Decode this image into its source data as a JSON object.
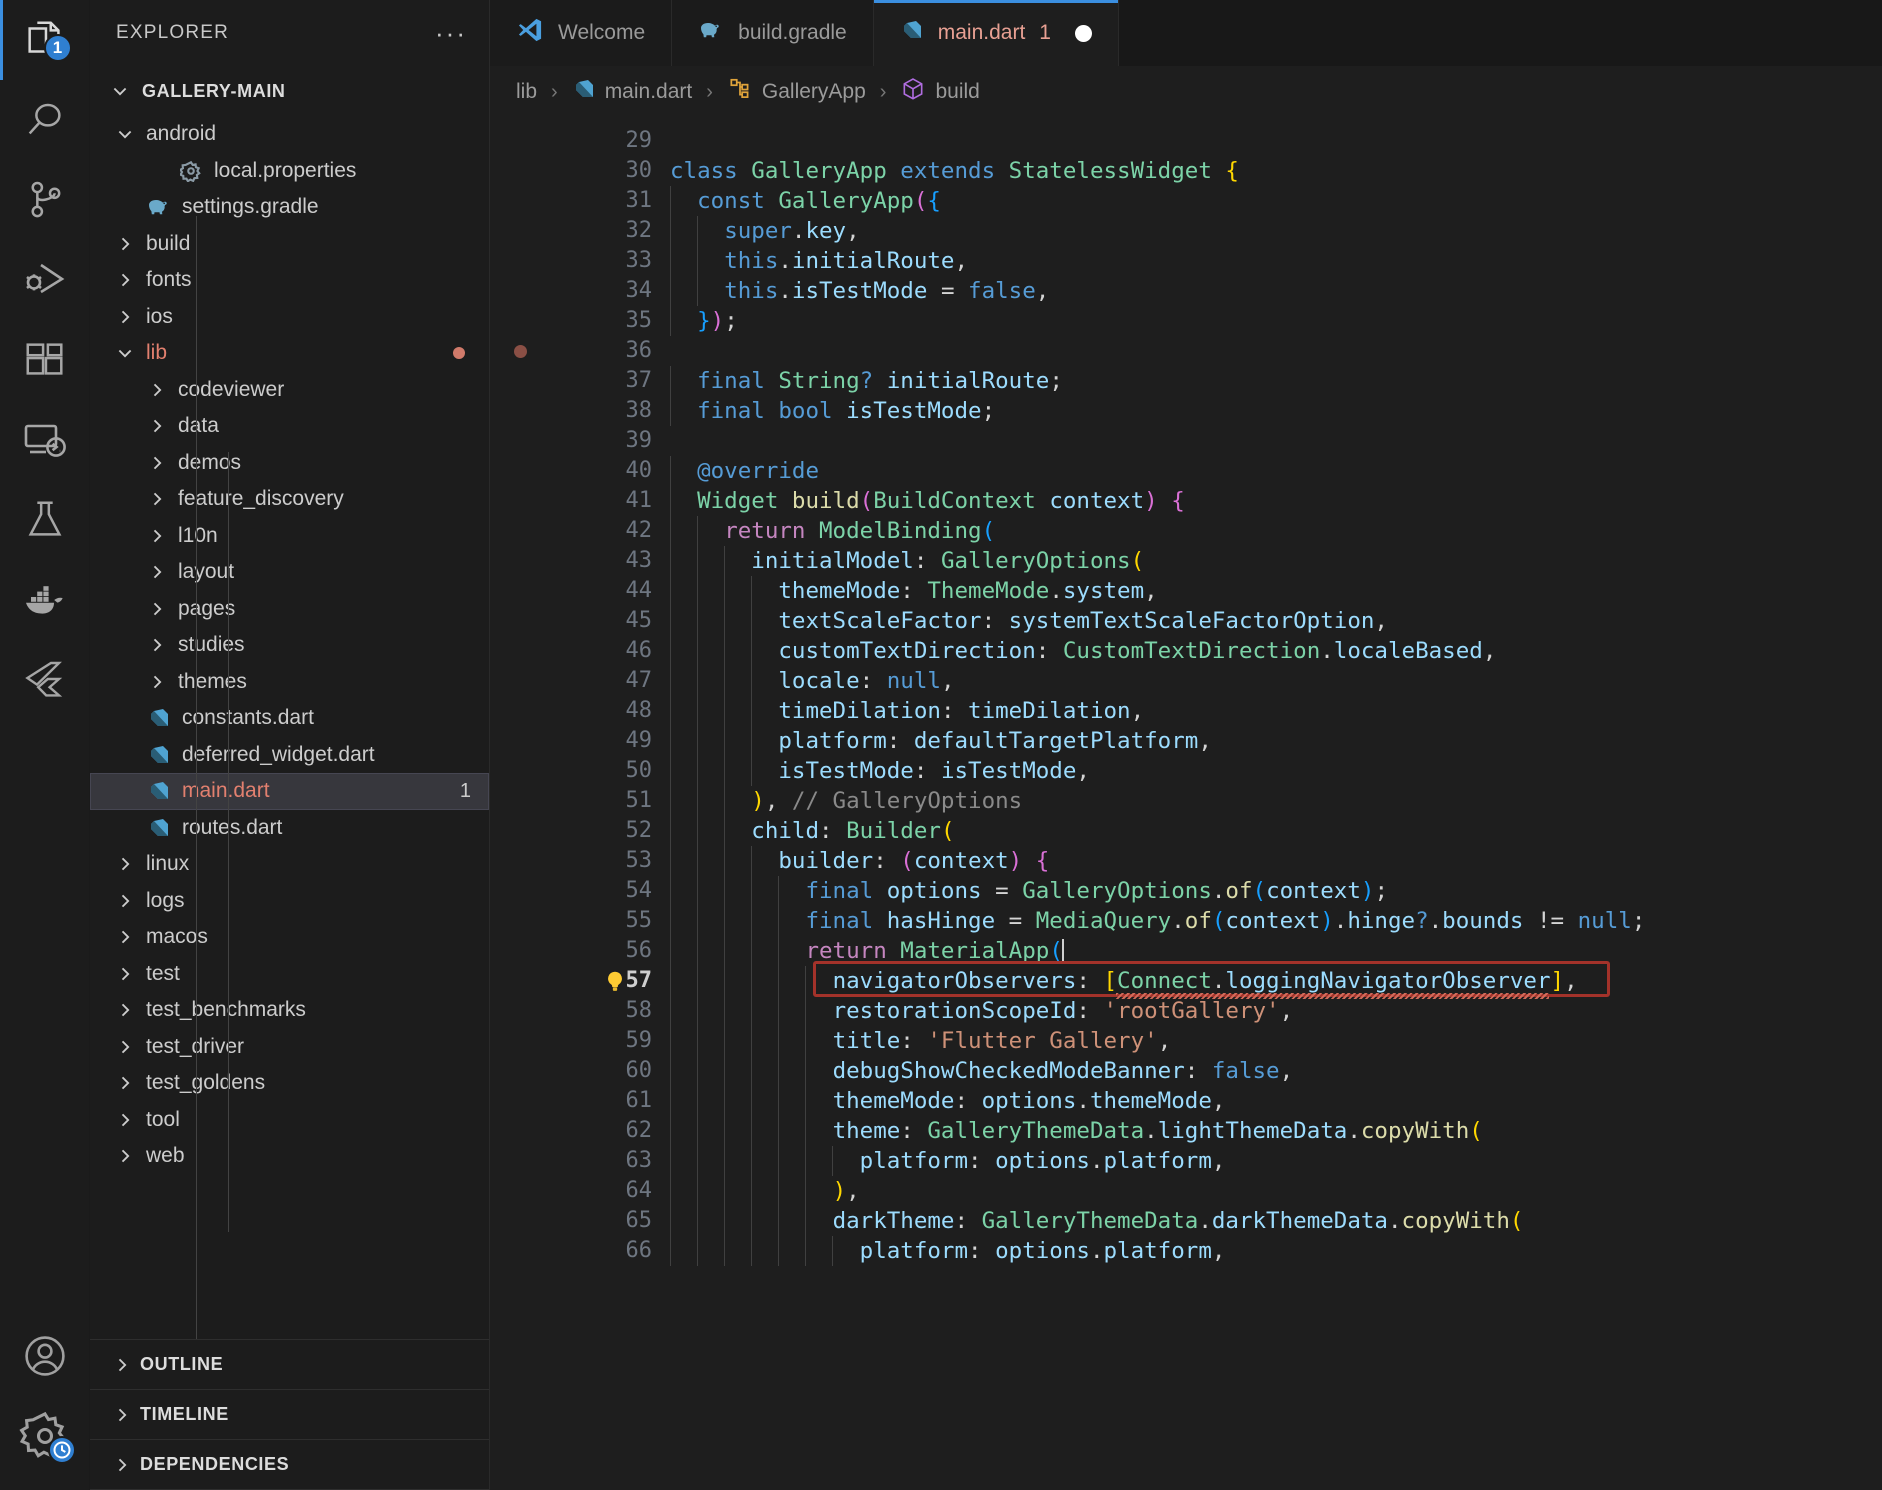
{
  "activity_bar": {
    "items": [
      {
        "name": "explorer",
        "icon": "files-icon",
        "badge": "1",
        "active": true
      },
      {
        "name": "search",
        "icon": "search-icon",
        "badge": "",
        "active": false
      },
      {
        "name": "source-control",
        "icon": "source-control-icon",
        "badge": "",
        "active": false
      },
      {
        "name": "run-and-debug",
        "icon": "run-debug-icon",
        "badge": "",
        "active": false
      },
      {
        "name": "extensions",
        "icon": "extensions-icon",
        "badge": "",
        "active": false
      },
      {
        "name": "remote-explorer",
        "icon": "remote-explorer-icon",
        "badge": "",
        "active": false
      },
      {
        "name": "testing",
        "icon": "beaker-icon",
        "badge": "",
        "active": false
      },
      {
        "name": "docker",
        "icon": "docker-whale-icon",
        "badge": "",
        "active": false
      },
      {
        "name": "flutter",
        "icon": "flutter-icon",
        "badge": "",
        "active": false
      }
    ],
    "bottom_items": [
      {
        "name": "accounts",
        "icon": "account-circle-icon"
      },
      {
        "name": "manage-settings",
        "icon": "gear-icon",
        "badge_icon": "clock-icon"
      }
    ]
  },
  "sidebar": {
    "title": "EXPLORER",
    "more_actions": "···",
    "workspace": "GALLERY-MAIN",
    "tree": [
      {
        "label": "android",
        "depth": 0,
        "kind": "folder",
        "expanded": true,
        "icon": "chevron-down-icon"
      },
      {
        "label": "local.properties",
        "depth": 2,
        "kind": "file",
        "icon": "gear-file-icon"
      },
      {
        "label": "settings.gradle",
        "depth": 1,
        "kind": "file",
        "icon": "gradle-elephant-icon"
      },
      {
        "label": "build",
        "depth": 0,
        "kind": "folder",
        "expanded": false,
        "icon": "chevron-right-icon"
      },
      {
        "label": "fonts",
        "depth": 0,
        "kind": "folder",
        "expanded": false,
        "icon": "chevron-right-icon"
      },
      {
        "label": "ios",
        "depth": 0,
        "kind": "folder",
        "expanded": false,
        "icon": "chevron-right-icon"
      },
      {
        "label": "lib",
        "depth": 0,
        "kind": "folder",
        "expanded": true,
        "icon": "chevron-down-icon",
        "modified": true,
        "dot": true
      },
      {
        "label": "codeviewer",
        "depth": 1,
        "kind": "folder",
        "expanded": false,
        "icon": "chevron-right-icon"
      },
      {
        "label": "data",
        "depth": 1,
        "kind": "folder",
        "expanded": false,
        "icon": "chevron-right-icon"
      },
      {
        "label": "demos",
        "depth": 1,
        "kind": "folder",
        "expanded": false,
        "icon": "chevron-right-icon"
      },
      {
        "label": "feature_discovery",
        "depth": 1,
        "kind": "folder",
        "expanded": false,
        "icon": "chevron-right-icon"
      },
      {
        "label": "l10n",
        "depth": 1,
        "kind": "folder",
        "expanded": false,
        "icon": "chevron-right-icon"
      },
      {
        "label": "layout",
        "depth": 1,
        "kind": "folder",
        "expanded": false,
        "icon": "chevron-right-icon"
      },
      {
        "label": "pages",
        "depth": 1,
        "kind": "folder",
        "expanded": false,
        "icon": "chevron-right-icon"
      },
      {
        "label": "studies",
        "depth": 1,
        "kind": "folder",
        "expanded": false,
        "icon": "chevron-right-icon"
      },
      {
        "label": "themes",
        "depth": 1,
        "kind": "folder",
        "expanded": false,
        "icon": "chevron-right-icon"
      },
      {
        "label": "constants.dart",
        "depth": 1,
        "kind": "file",
        "icon": "dart-icon"
      },
      {
        "label": "deferred_widget.dart",
        "depth": 1,
        "kind": "file",
        "icon": "dart-icon"
      },
      {
        "label": "main.dart",
        "depth": 1,
        "kind": "file",
        "icon": "dart-icon",
        "modified": true,
        "selected": true,
        "count": "1"
      },
      {
        "label": "routes.dart",
        "depth": 1,
        "kind": "file",
        "icon": "dart-icon"
      },
      {
        "label": "linux",
        "depth": 0,
        "kind": "folder",
        "expanded": false,
        "icon": "chevron-right-icon"
      },
      {
        "label": "logs",
        "depth": 0,
        "kind": "folder",
        "expanded": false,
        "icon": "chevron-right-icon"
      },
      {
        "label": "macos",
        "depth": 0,
        "kind": "folder",
        "expanded": false,
        "icon": "chevron-right-icon"
      },
      {
        "label": "test",
        "depth": 0,
        "kind": "folder",
        "expanded": false,
        "icon": "chevron-right-icon"
      },
      {
        "label": "test_benchmarks",
        "depth": 0,
        "kind": "folder",
        "expanded": false,
        "icon": "chevron-right-icon"
      },
      {
        "label": "test_driver",
        "depth": 0,
        "kind": "folder",
        "expanded": false,
        "icon": "chevron-right-icon"
      },
      {
        "label": "test_goldens",
        "depth": 0,
        "kind": "folder",
        "expanded": false,
        "icon": "chevron-right-icon"
      },
      {
        "label": "tool",
        "depth": 0,
        "kind": "folder",
        "expanded": false,
        "icon": "chevron-right-icon"
      },
      {
        "label": "web",
        "depth": 0,
        "kind": "folder",
        "expanded": false,
        "icon": "chevron-right-icon"
      }
    ],
    "bottom_sections": [
      {
        "label": "OUTLINE",
        "icon": "chevron-right-icon"
      },
      {
        "label": "TIMELINE",
        "icon": "chevron-right-icon"
      },
      {
        "label": "DEPENDENCIES",
        "icon": "chevron-right-icon"
      }
    ]
  },
  "tabs": [
    {
      "label": "Welcome",
      "icon": "vscode-logo-icon",
      "active": false,
      "dirty": false,
      "count": ""
    },
    {
      "label": "build.gradle",
      "icon": "gradle-elephant-icon",
      "active": false,
      "dirty": false,
      "count": ""
    },
    {
      "label": "main.dart",
      "icon": "dart-icon",
      "active": true,
      "dirty": true,
      "count": "1"
    }
  ],
  "breadcrumb": [
    {
      "label": "lib",
      "icon": ""
    },
    {
      "label": "main.dart",
      "icon": "dart-icon"
    },
    {
      "label": "GalleryApp",
      "icon": "class-symbol-icon"
    },
    {
      "label": "build",
      "icon": "method-symbol-icon"
    }
  ],
  "editor": {
    "first_line": 29,
    "current_line": 57,
    "breakpoint_line": 36,
    "lightbulb_line": 57,
    "error_line_text": "navigatorObservers: [Connect.loggingNavigatorObserver],",
    "lines": [
      {
        "n": 29,
        "text": ""
      },
      {
        "n": 30,
        "text": "class GalleryApp extends StatelessWidget {"
      },
      {
        "n": 31,
        "text": "  const GalleryApp({"
      },
      {
        "n": 32,
        "text": "    super.key,"
      },
      {
        "n": 33,
        "text": "    this.initialRoute,"
      },
      {
        "n": 34,
        "text": "    this.isTestMode = false,"
      },
      {
        "n": 35,
        "text": "  });"
      },
      {
        "n": 36,
        "text": ""
      },
      {
        "n": 37,
        "text": "  final String? initialRoute;"
      },
      {
        "n": 38,
        "text": "  final bool isTestMode;"
      },
      {
        "n": 39,
        "text": ""
      },
      {
        "n": 40,
        "text": "  @override"
      },
      {
        "n": 41,
        "text": "  Widget build(BuildContext context) {"
      },
      {
        "n": 42,
        "text": "    return ModelBinding("
      },
      {
        "n": 43,
        "text": "      initialModel: GalleryOptions("
      },
      {
        "n": 44,
        "text": "        themeMode: ThemeMode.system,"
      },
      {
        "n": 45,
        "text": "        textScaleFactor: systemTextScaleFactorOption,"
      },
      {
        "n": 46,
        "text": "        customTextDirection: CustomTextDirection.localeBased,"
      },
      {
        "n": 47,
        "text": "        locale: null,"
      },
      {
        "n": 48,
        "text": "        timeDilation: timeDilation,"
      },
      {
        "n": 49,
        "text": "        platform: defaultTargetPlatform,"
      },
      {
        "n": 50,
        "text": "        isTestMode: isTestMode,"
      },
      {
        "n": 51,
        "text": "      ), // GalleryOptions"
      },
      {
        "n": 52,
        "text": "      child: Builder("
      },
      {
        "n": 53,
        "text": "        builder: (context) {"
      },
      {
        "n": 54,
        "text": "          final options = GalleryOptions.of(context);"
      },
      {
        "n": 55,
        "text": "          final hasHinge = MediaQuery.of(context).hinge?.bounds != null;"
      },
      {
        "n": 56,
        "text": "          return MaterialApp("
      },
      {
        "n": 57,
        "text": "            navigatorObservers: [Connect.loggingNavigatorObserver],"
      },
      {
        "n": 58,
        "text": "            restorationScopeId: 'rootGallery',"
      },
      {
        "n": 59,
        "text": "            title: 'Flutter Gallery',"
      },
      {
        "n": 60,
        "text": "            debugShowCheckedModeBanner: false,"
      },
      {
        "n": 61,
        "text": "            themeMode: options.themeMode,"
      },
      {
        "n": 62,
        "text": "            theme: GalleryThemeData.lightThemeData.copyWith("
      },
      {
        "n": 63,
        "text": "              platform: options.platform,"
      },
      {
        "n": 64,
        "text": "            ),"
      },
      {
        "n": 65,
        "text": "            darkTheme: GalleryThemeData.darkThemeData.copyWith("
      },
      {
        "n": 66,
        "text": "              platform: options.platform,"
      }
    ]
  },
  "colors": {
    "accent": "#3b8fe0",
    "error_box": "#a3322a",
    "modified_file": "#e2806f",
    "badge": "#2f7fd1",
    "editor_bg": "#1e1e1e",
    "sidebar_bg": "#1c1c1c"
  }
}
